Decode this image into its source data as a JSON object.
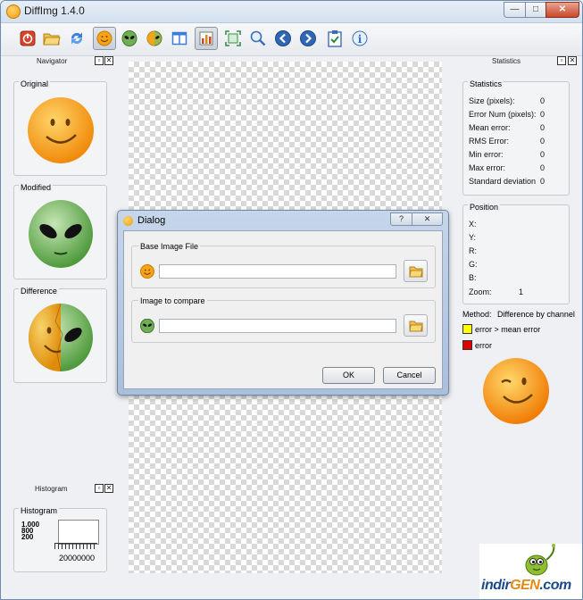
{
  "window": {
    "title": "DiffImg 1.4.0",
    "min": "—",
    "max": "□",
    "close": "✕"
  },
  "toolbar": {
    "buttons": [
      {
        "name": "quit-icon",
        "color": "#d8432a"
      },
      {
        "name": "open-folder-icon",
        "color": "#f2c14e"
      },
      {
        "name": "refresh-icon",
        "color": "#3b7dd8"
      },
      {
        "name": "smiley-icon",
        "color": "#f6a317"
      },
      {
        "name": "alien-icon",
        "color": "#6fae56"
      },
      {
        "name": "difference-icon",
        "color": "#9bb84a"
      },
      {
        "name": "split-view-icon",
        "color": "#3b7dd8"
      },
      {
        "name": "chart-icon",
        "color": "#c8472b"
      },
      {
        "name": "fit-view-icon",
        "color": "#3a8c4a"
      },
      {
        "name": "zoom-icon",
        "color": "#3b6fb8"
      },
      {
        "name": "previous-icon",
        "color": "#2f67b3"
      },
      {
        "name": "next-icon",
        "color": "#2f67b3"
      },
      {
        "name": "checklist-icon",
        "color": "#3b6fb8"
      },
      {
        "name": "info-icon",
        "color": "#3b6fb8"
      }
    ]
  },
  "navigator": {
    "title": "Navigator",
    "original": "Original",
    "modified": "Modified",
    "difference": "Difference"
  },
  "histogram_dock": {
    "title": "Histogram",
    "group": "Histogram",
    "y_labels": [
      "1.000",
      "800",
      "200"
    ],
    "x_labels": "20000000"
  },
  "statistics": {
    "dock_title": "Statistics",
    "group": "Statistics",
    "rows": [
      {
        "label": "Size (pixels):",
        "value": "0"
      },
      {
        "label": "Error Num (pixels):",
        "value": "0"
      },
      {
        "label": "Mean error:",
        "value": "0"
      },
      {
        "label": "RMS Error:",
        "value": "0"
      },
      {
        "label": "Min error:",
        "value": "0"
      },
      {
        "label": "Max error:",
        "value": "0"
      },
      {
        "label": "Standard deviation",
        "value": "0"
      }
    ]
  },
  "position": {
    "group": "Position",
    "rows": [
      {
        "label": "X:",
        "value": ""
      },
      {
        "label": "Y:",
        "value": ""
      },
      {
        "label": "R:",
        "value": ""
      },
      {
        "label": "G:",
        "value": ""
      },
      {
        "label": "B:",
        "value": ""
      },
      {
        "label": "Zoom:",
        "value": "1"
      }
    ]
  },
  "method": {
    "label": "Method:",
    "value": "Difference by channel",
    "legend": [
      {
        "label": "error > mean error",
        "color": "#ffff00"
      },
      {
        "label": "error",
        "color": "#e00000"
      }
    ]
  },
  "dialog": {
    "title": "Dialog",
    "help": "?",
    "close": "✕",
    "base_group": "Base Image File",
    "base_value": "",
    "compare_group": "Image to compare",
    "compare_value": "",
    "ok": "OK",
    "cancel": "Cancel"
  },
  "watermark": {
    "prefix": "indir",
    "brand": "GEN",
    "suffix": ".com"
  }
}
